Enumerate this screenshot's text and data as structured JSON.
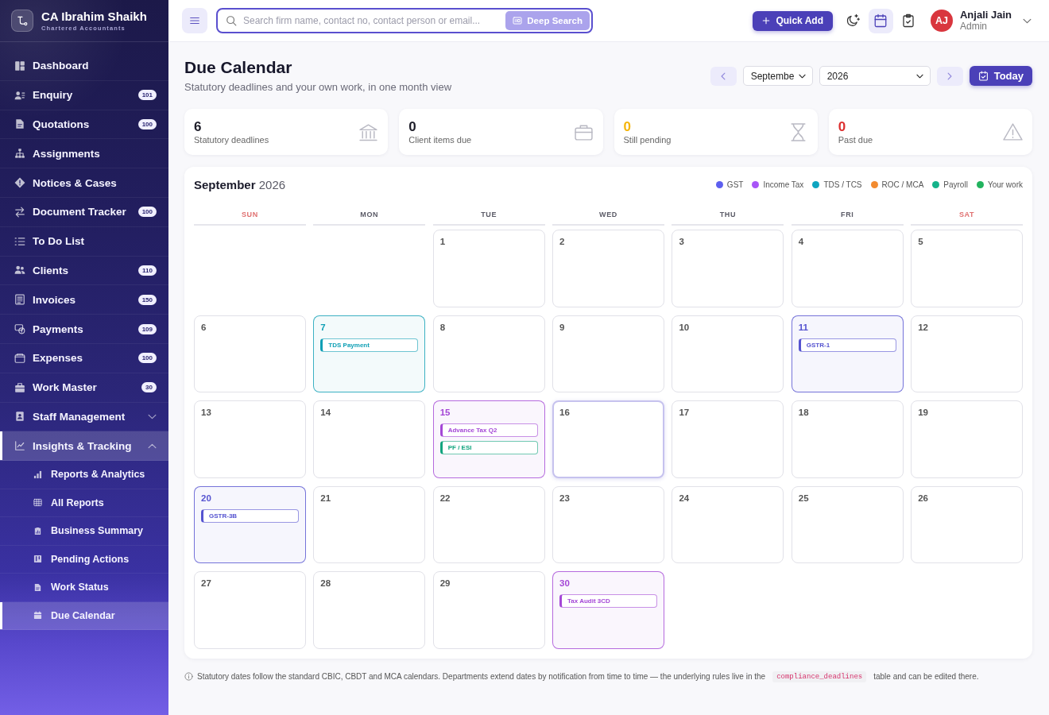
{
  "sidebar": {
    "brand": {
      "name": "CA Ibrahim Shaikh",
      "tagline": "Chartered Accountants"
    },
    "items": [
      {
        "kind": "link",
        "label": "Dashboard",
        "selected": false
      },
      {
        "kind": "link",
        "label": "Enquiry",
        "badge": "101",
        "selected": false
      },
      {
        "kind": "link",
        "label": "Quotations",
        "badge": "100",
        "selected": false
      },
      {
        "kind": "link",
        "label": "Assignments",
        "selected": false
      },
      {
        "kind": "link",
        "label": "Notices & Cases",
        "selected": false
      },
      {
        "kind": "link",
        "label": "Document Tracker",
        "badge": "100",
        "selected": false
      },
      {
        "kind": "link",
        "label": "To Do List",
        "selected": false
      },
      {
        "kind": "link",
        "label": "Clients",
        "badge": "110",
        "selected": false
      },
      {
        "kind": "link",
        "label": "Invoices",
        "badge": "150",
        "selected": false
      },
      {
        "kind": "link",
        "label": "Payments",
        "badge": "109",
        "selected": false
      },
      {
        "kind": "link",
        "label": "Expenses",
        "badge": "100",
        "selected": false
      },
      {
        "kind": "link",
        "label": "Work Master",
        "badge": "30",
        "selected": false
      },
      {
        "kind": "group",
        "label": "Staff Management",
        "expanded": false,
        "selected": false
      },
      {
        "kind": "group",
        "label": "Insights & Tracking",
        "expanded": true,
        "selected": true,
        "children": [
          {
            "label": "Reports & Analytics",
            "selected": false
          },
          {
            "label": "All Reports",
            "selected": false
          },
          {
            "label": "Business Summary",
            "selected": false
          },
          {
            "label": "Pending Actions",
            "selected": false
          },
          {
            "label": "Work Status",
            "selected": false
          },
          {
            "label": "Due Calendar",
            "selected": true
          }
        ]
      }
    ]
  },
  "topbar": {
    "search": {
      "placeholder": "Search firm name, contact no, contact person or email...",
      "button": "Deep Search"
    },
    "quick_add": "Quick Add",
    "icon_buttons": [
      {
        "selected": false
      },
      {
        "selected": true
      },
      {
        "selected": false
      }
    ],
    "user": {
      "initials": "AJ",
      "name": "Anjali Jain",
      "role": "Admin"
    }
  },
  "header": {
    "title": "Due Calendar",
    "subtitle": "Statutory deadlines and your own work, in one month view",
    "month": "Septembe",
    "year": "2026",
    "today_button": "Today"
  },
  "stats": [
    {
      "value": "6",
      "label": "Statutory deadlines",
      "color": "#1c1c28"
    },
    {
      "value": "0",
      "label": "Client items due",
      "color": "#1c1c28"
    },
    {
      "value": "0",
      "label": "Still pending",
      "color": "#f5b50a"
    },
    {
      "value": "0",
      "label": "Past due",
      "color": "#dc2f2f"
    }
  ],
  "calendar": {
    "title": "**September** 2026",
    "legend": [
      {
        "label": "GST",
        "color": "#5d5fef"
      },
      {
        "label": "Income Tax",
        "color": "#a855f7"
      },
      {
        "label": "TDS / TCS",
        "color": "#0ea5c0"
      },
      {
        "label": "ROC / MCA",
        "color": "#f28b30"
      },
      {
        "label": "Payroll",
        "color": "#14b38a"
      },
      {
        "label": "Your work",
        "color": "#22b35e"
      }
    ],
    "weekdays": [
      {
        "label": "SUN",
        "weekend": true
      },
      {
        "label": "MON",
        "weekend": false
      },
      {
        "label": "TUE",
        "weekend": false
      },
      {
        "label": "WED",
        "weekend": false
      },
      {
        "label": "THU",
        "weekend": false
      },
      {
        "label": "FRI",
        "weekend": false
      },
      {
        "label": "SAT",
        "weekend": true
      }
    ],
    "weeks": [
      {
        "days": [
          {
            "kind": "blank"
          },
          {
            "kind": "blank"
          },
          {
            "kind": "day",
            "date": "1",
            "today": false
          },
          {
            "kind": "day",
            "date": "2",
            "today": false
          },
          {
            "kind": "day",
            "date": "3",
            "today": false
          },
          {
            "kind": "day",
            "date": "4",
            "today": false
          },
          {
            "kind": "day",
            "date": "5",
            "today": false
          }
        ]
      },
      {
        "days": [
          {
            "kind": "day",
            "date": "6",
            "today": false
          },
          {
            "kind": "day",
            "date": "7",
            "today": false,
            "events": [
              {
                "label": "TDS Payment",
                "color": "#0e9fb5"
              }
            ]
          },
          {
            "kind": "day",
            "date": "8",
            "today": false
          },
          {
            "kind": "day",
            "date": "9",
            "today": false
          },
          {
            "kind": "day",
            "date": "10",
            "today": false
          },
          {
            "kind": "day",
            "date": "11",
            "today": false,
            "events": [
              {
                "label": "GSTR-1",
                "color": "#5553d0"
              }
            ]
          },
          {
            "kind": "day",
            "date": "12",
            "today": false
          }
        ]
      },
      {
        "days": [
          {
            "kind": "day",
            "date": "13",
            "today": false
          },
          {
            "kind": "day",
            "date": "14",
            "today": false
          },
          {
            "kind": "day",
            "date": "15",
            "today": false,
            "events": [
              {
                "label": "Advance Tax Q2",
                "color": "#a447d6"
              },
              {
                "label": "PF / ESI",
                "color": "#12a47e"
              }
            ]
          },
          {
            "kind": "day",
            "date": "16",
            "today": true
          },
          {
            "kind": "day",
            "date": "17",
            "today": false
          },
          {
            "kind": "day",
            "date": "18",
            "today": false
          },
          {
            "kind": "day",
            "date": "19",
            "today": false
          }
        ]
      },
      {
        "days": [
          {
            "kind": "day",
            "date": "20",
            "today": false,
            "events": [
              {
                "label": "GSTR-3B",
                "color": "#5553d0"
              }
            ]
          },
          {
            "kind": "day",
            "date": "21",
            "today": false
          },
          {
            "kind": "day",
            "date": "22",
            "today": false
          },
          {
            "kind": "day",
            "date": "23",
            "today": false
          },
          {
            "kind": "day",
            "date": "24",
            "today": false
          },
          {
            "kind": "day",
            "date": "25",
            "today": false
          },
          {
            "kind": "day",
            "date": "26",
            "today": false
          }
        ]
      },
      {
        "days": [
          {
            "kind": "day",
            "date": "27",
            "today": false
          },
          {
            "kind": "day",
            "date": "28",
            "today": false
          },
          {
            "kind": "day",
            "date": "29",
            "today": false
          },
          {
            "kind": "day",
            "date": "30",
            "today": false,
            "events": [
              {
                "label": "Tax Audit 3CD",
                "color": "#a447d6"
              }
            ]
          }
        ]
      }
    ]
  },
  "note": {
    "text": "Statutory dates follow the standard CBIC, CBDT and MCA calendars. Departments extend dates by notification from time to time — the underlying rules live in the",
    "code": "compliance_deadlines",
    "text_after": "table and can be edited there."
  }
}
